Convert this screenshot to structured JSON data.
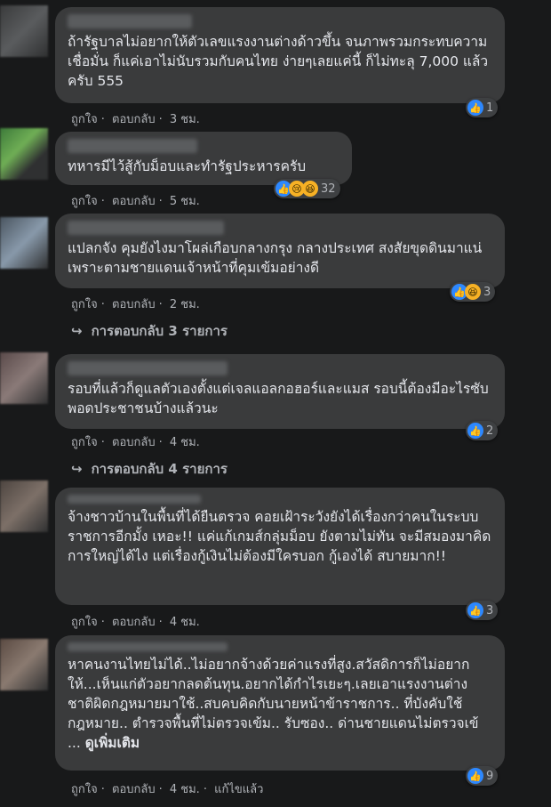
{
  "comments": [
    {
      "text": "ถ้ารัฐบาลไม่อยากให้ตัวเลขแรงงานต่างด้าวขึ้น จนภาพรวมกระทบความเชื่อมั่น ก็แค่เอาไม่นับรวมกับคนไทย ง่ายๆเลยแค่นี้ ก็ไม่ทะลุ 7,000 แล้วครับ 555",
      "like_label": "ถูกใจ",
      "reply_label": "ตอบกลับ",
      "time": "3 ชม.",
      "reaction_count": "1"
    },
    {
      "text": "ทหารมีไว้สู้กับม็อบและทำรัฐประหารครับ",
      "like_label": "ถูกใจ",
      "reply_label": "ตอบกลับ",
      "time": "5 ชม.",
      "reaction_count": "32"
    },
    {
      "text": "แปลกจัง คุมยังไงมาโผล่เกือบกลางกรุง กลางประเทศ สงสัยขุดดินมาแน่ เพราะตามชายแดนเจ้าหน้าที่คุมเข้มอย่างดี",
      "like_label": "ถูกใจ",
      "reply_label": "ตอบกลับ",
      "time": "2 ชม.",
      "reaction_count": "3",
      "replies": "การตอบกลับ 3 รายการ"
    },
    {
      "text": "รอบที่แล้วก็ดูแลตัวเองตั้งแต่เจลแอลกอฮอร์และแมส รอบนี้ต้องมีอะไรซับพอดประชาชนบ้างแล้วนะ",
      "like_label": "ถูกใจ",
      "reply_label": "ตอบกลับ",
      "time": "4 ชม.",
      "reaction_count": "2",
      "replies": "การตอบกลับ 4 รายการ"
    },
    {
      "text": "จ้างชาวบ้านในพื้นที่ได้ยืนตรวจ คอยเฝ้าระวังยังได้เรื่องกว่าคนในระบบราชการอีกมั้ง เหอะ!! แค่แก้เกมส์กลุ่มม็อบ ยังตามไม่ทัน จะมีสมองมาคิดการใหญ่ได้ไง แต่เรื่องกู้เงินไม่ต้องมีใครบอก กู้เองได้ สบายมาก!!",
      "like_label": "ถูกใจ",
      "reply_label": "ตอบกลับ",
      "time": "4 ชม.",
      "reaction_count": "3"
    },
    {
      "text": "หาคนงานไทยไม่ได้..ไม่อยากจ้างด้วยค่าแรงที่สูง.สวัสดิการก็ไม่อยากให้...เห็นแก่ตัวอยากลดต้นทุน.อยากได้กำไรเยะๆ.เลยเอาแรงงานต่างชาติผิดกฎหมายมาใช้..สบคบคิดกับนายหน้าข้าราชการ.. ที่บังคับใช้กฎหมาย.. ตำรวจพื้นที่ไม่ตรวจเข้ม.. รับซอง.. ด่านชายแดนไม่ตรวจเข้ ...",
      "see_more": "ดูเพิ่มเติม",
      "like_label": "ถูกใจ",
      "reply_label": "ตอบกลับ",
      "time": "4 ชม.",
      "edited_label": "แก้ไขแล้ว",
      "reaction_count": "9"
    }
  ]
}
